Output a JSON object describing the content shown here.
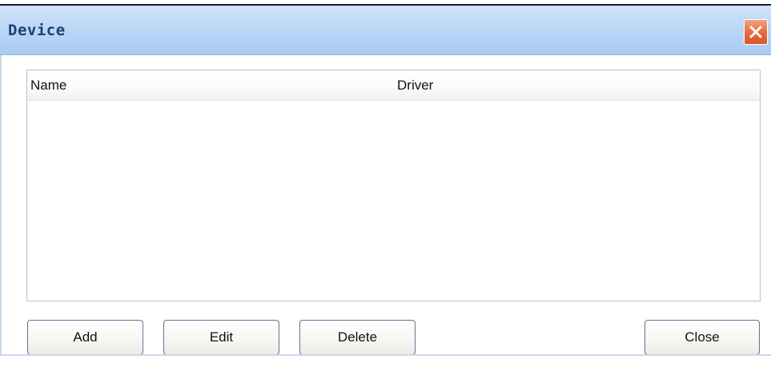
{
  "window": {
    "title": "Device",
    "close_icon": "close-x-icon"
  },
  "list": {
    "columns": [
      "Name",
      "Driver"
    ],
    "rows": []
  },
  "buttons": {
    "add": "Add",
    "edit": "Edit",
    "delete": "Delete",
    "close": "Close"
  },
  "colors": {
    "titlebar": "#bcd7f6",
    "title_text": "#1e3f74",
    "close_button": "#e4693c",
    "button_border": "#5f7691"
  }
}
